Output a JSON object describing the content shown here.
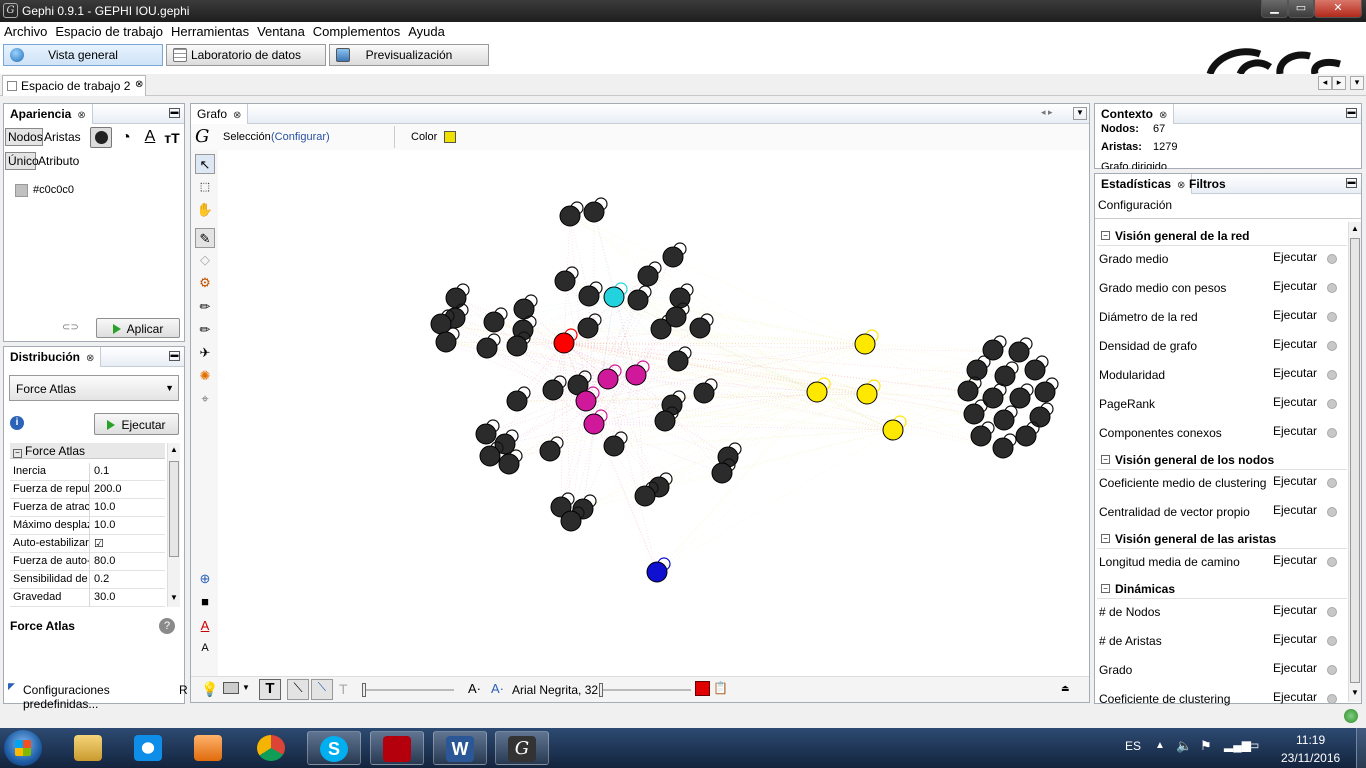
{
  "window": {
    "title": "Gephi 0.9.1 - GEPHI IOU.gephi",
    "app_icon": "gephi-icon",
    "buttons": {
      "minimize": "▁",
      "maximize": "▭",
      "close": "✕"
    }
  },
  "menu": [
    "Archivo",
    "Espacio de trabajo",
    "Herramientas",
    "Ventana",
    "Complementos",
    "Ayuda"
  ],
  "modes": {
    "overview": "Vista general",
    "data_lab": "Laboratorio de datos",
    "preview": "Previsualización"
  },
  "workspace_tab": "Espacio de trabajo 2",
  "appearance": {
    "title": "Apariencia",
    "tabs": {
      "nodes": "Nodos",
      "edges": "Aristas"
    },
    "subtabs": {
      "unique": "Único",
      "attribute": "Atributo"
    },
    "color_value": "#c0c0c0",
    "apply": "Aplicar"
  },
  "layout": {
    "title": "Distribución",
    "algorithm": "Force Atlas",
    "run": "Ejecutar",
    "section": "Force Atlas",
    "properties": [
      {
        "k": "Inercia",
        "v": "0.1"
      },
      {
        "k": "Fuerza de repulsión",
        "v": "200.0"
      },
      {
        "k": "Fuerza de atracción",
        "v": "10.0"
      },
      {
        "k": "Máximo desplazamiento",
        "v": "10.0"
      },
      {
        "k": "Auto-estabilizar",
        "v": "☑"
      },
      {
        "k": "Fuerza de auto-estabilización",
        "v": "80.0"
      },
      {
        "k": "Sensibilidad de auto-estabilización",
        "v": "0.2"
      },
      {
        "k": "Gravedad",
        "v": "30.0"
      }
    ],
    "desc_title": "Force Atlas",
    "presets": "Configuraciones predefinidas...",
    "presets_tail": "R"
  },
  "graph": {
    "tab": "Grafo",
    "selection_label": "Selección",
    "configure": "(Configurar)",
    "color_label": "Color",
    "color_swatch": "#f0e000",
    "font_label": "Arial Negrita, 32",
    "label_color": "#e00000"
  },
  "context": {
    "title": "Contexto",
    "nodes_label": "Nodos:",
    "nodes": "67",
    "edges_label": "Aristas:",
    "edges": "1279",
    "directed": "Grafo dirigido"
  },
  "statistics": {
    "tabs": {
      "stats": "Estadísticas",
      "filters": "Filtros"
    },
    "settings": "Configuración",
    "run": "Ejecutar",
    "sections": [
      {
        "title": "Visión general de la red",
        "items": [
          "Grado medio",
          "Grado medio con pesos",
          "Diámetro de la red",
          "Densidad de grafo",
          "Modularidad",
          "PageRank",
          "Componentes conexos"
        ]
      },
      {
        "title": "Visión general de los nodos",
        "items": [
          "Coeficiente medio de clustering",
          "Centralidad de vector propio"
        ]
      },
      {
        "title": "Visión general de las aristas",
        "items": [
          "Longitud media de camino"
        ]
      },
      {
        "title": "Dinámicas",
        "items": [
          "# de Nodos",
          "# de Aristas",
          "Grado",
          "Coeficiente de clustering"
        ]
      }
    ]
  },
  "taskbar": {
    "lang": "ES",
    "time": "11:19",
    "date": "23/11/2016"
  }
}
